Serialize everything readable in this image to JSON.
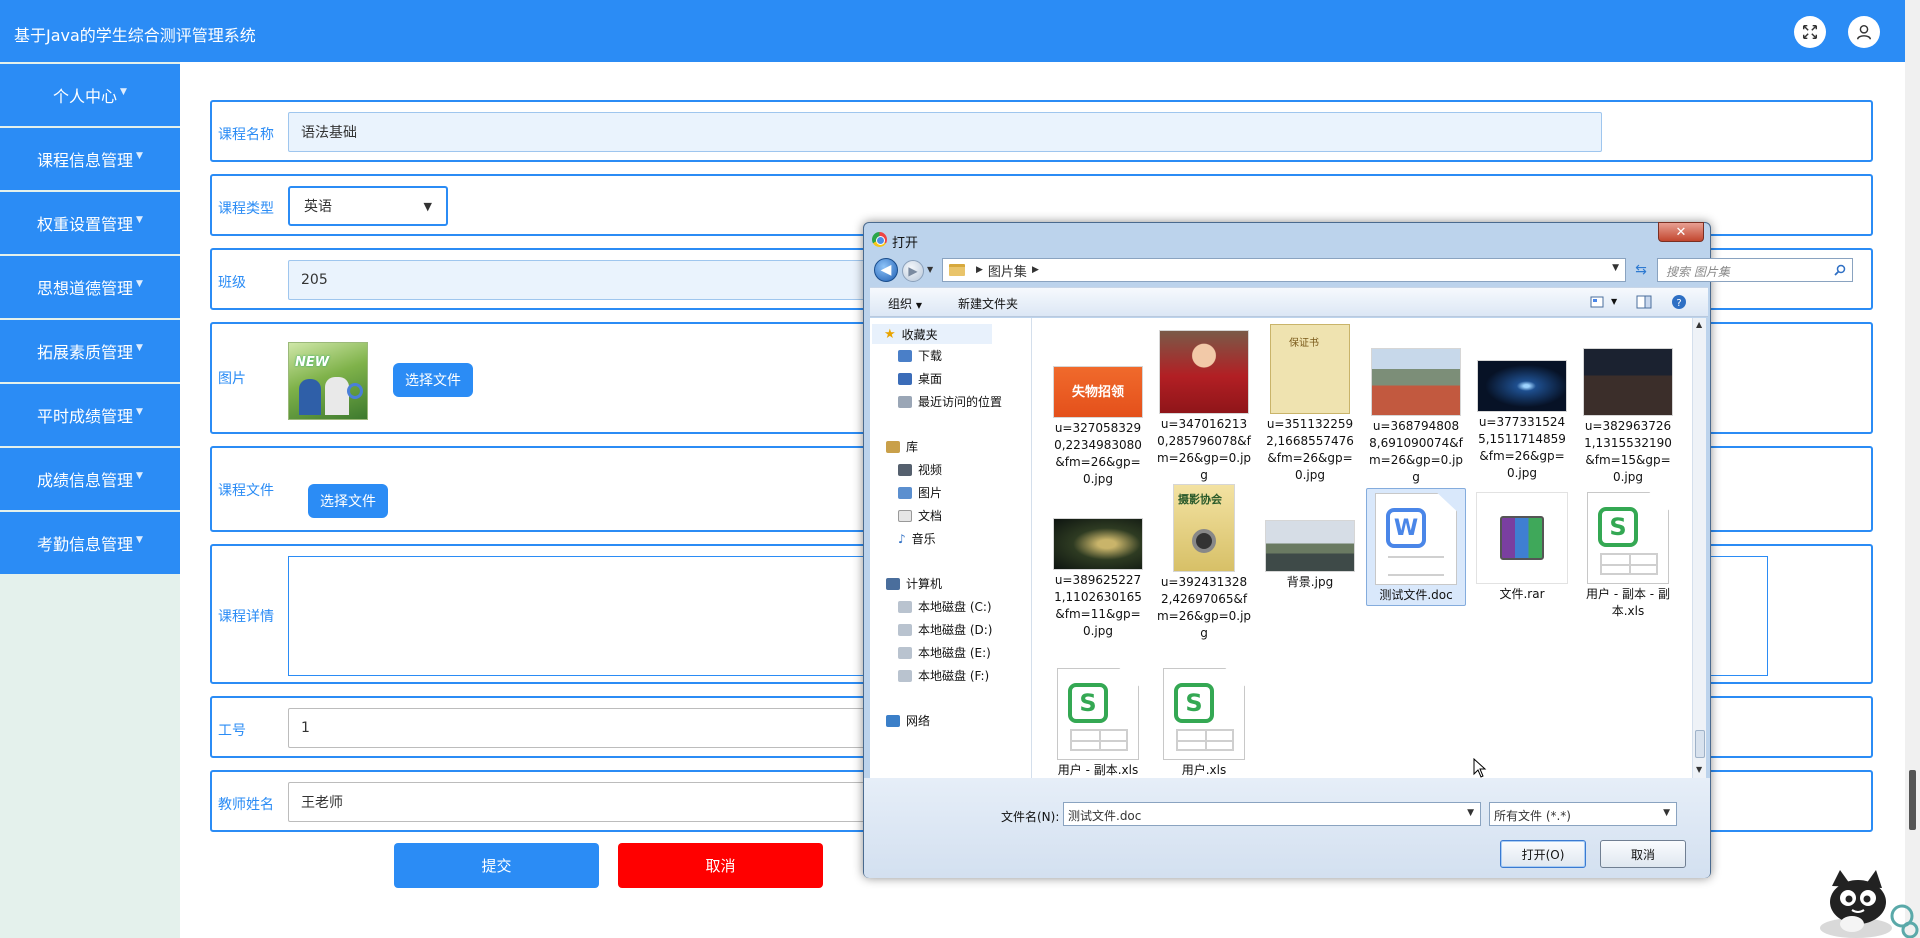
{
  "header": {
    "title": "基于Java的学生综合测评管理系统"
  },
  "sidebar": {
    "items": [
      {
        "label": "个人中心"
      },
      {
        "label": "课程信息管理"
      },
      {
        "label": "权重设置管理"
      },
      {
        "label": "思想道德管理"
      },
      {
        "label": "拓展素质管理"
      },
      {
        "label": "平时成绩管理"
      },
      {
        "label": "成绩信息管理"
      },
      {
        "label": "考勤信息管理"
      }
    ]
  },
  "form": {
    "course_name": {
      "label": "课程名称",
      "value": "语法基础"
    },
    "course_type": {
      "label": "课程类型",
      "value": "英语"
    },
    "class": {
      "label": "班级",
      "value": "205"
    },
    "image": {
      "label": "图片",
      "button": "选择文件",
      "thumb_text": "NEW"
    },
    "course_file": {
      "label": "课程文件",
      "button": "选择文件"
    },
    "course_detail": {
      "label": "课程详情"
    },
    "job_no": {
      "label": "工号",
      "value": "1"
    },
    "teacher_name": {
      "label": "教师姓名",
      "value": "王老师"
    },
    "submit": "提交",
    "cancel": "取消"
  },
  "dialog": {
    "title": "打开",
    "close": "✕",
    "path": [
      "图片集"
    ],
    "search_placeholder": "搜索 图片集",
    "toolbar": {
      "organize": "组织",
      "new_folder": "新建文件夹"
    },
    "nav": {
      "favorites": "收藏夹",
      "downloads": "下载",
      "desktop": "桌面",
      "recent": "最近访问的位置",
      "libraries": "库",
      "videos": "视频",
      "pictures": "图片",
      "documents": "文档",
      "music": "音乐",
      "computer": "计算机",
      "disk_c": "本地磁盘 (C:)",
      "disk_d": "本地磁盘 (D:)",
      "disk_e": "本地磁盘 (E:)",
      "disk_f": "本地磁盘 (F:)",
      "network": "网络"
    },
    "files": [
      {
        "name": "u=3270583290,2234983080&fm=26&gp=0.jpg",
        "thumb_text": "失物招领"
      },
      {
        "name": "u=3470162130,285796078&fm=26&gp=0.jpg"
      },
      {
        "name": "u=3511322592,1668557476&fm=26&gp=0.jpg",
        "thumb_text": "保证书"
      },
      {
        "name": "u=3687948088,691090074&fm=26&gp=0.jpg"
      },
      {
        "name": "u=3773315245,1511714859&fm=26&gp=0.jpg"
      },
      {
        "name": "u=3829637261,1315532190&fm=15&gp=0.jpg"
      },
      {
        "name": "u=3896252271,1102630165&fm=11&gp=0.jpg"
      },
      {
        "name": "u=3924313282,42697065&fm=26&gp=0.jpg",
        "thumb_text": "摄影协会"
      },
      {
        "name": "背景.jpg"
      },
      {
        "name": "测试文件.doc",
        "selected": true
      },
      {
        "name": "文件.rar"
      },
      {
        "name": "用户 - 副本 - 副本.xls"
      },
      {
        "name": "用户 - 副本.xls"
      },
      {
        "name": "用户.xls"
      }
    ],
    "filename_label": "文件名(N):",
    "filename_value": "测试文件.doc",
    "filter": "所有文件 (*.*)",
    "open_button": "打开(O)",
    "cancel_button": "取消"
  },
  "colors": {
    "primary": "#2b8cf5",
    "danger": "#ff0000",
    "sidebar_bg": "#e4f1ec"
  }
}
